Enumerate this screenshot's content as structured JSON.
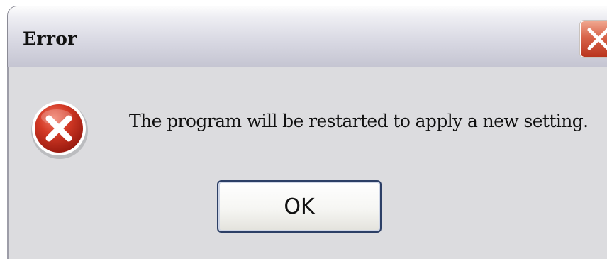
{
  "dialog": {
    "title": "Error",
    "message": "The program will be restarted to apply a new setting.",
    "ok_label": "OK",
    "icon": "error-icon",
    "close_icon": "close-icon"
  },
  "colors": {
    "titlebar_bg": "#d5d5e0",
    "body_bg": "#dcdcdf",
    "close_button": "#d0533a",
    "error_icon": "#c8281c",
    "ok_border": "#2c3f66"
  }
}
